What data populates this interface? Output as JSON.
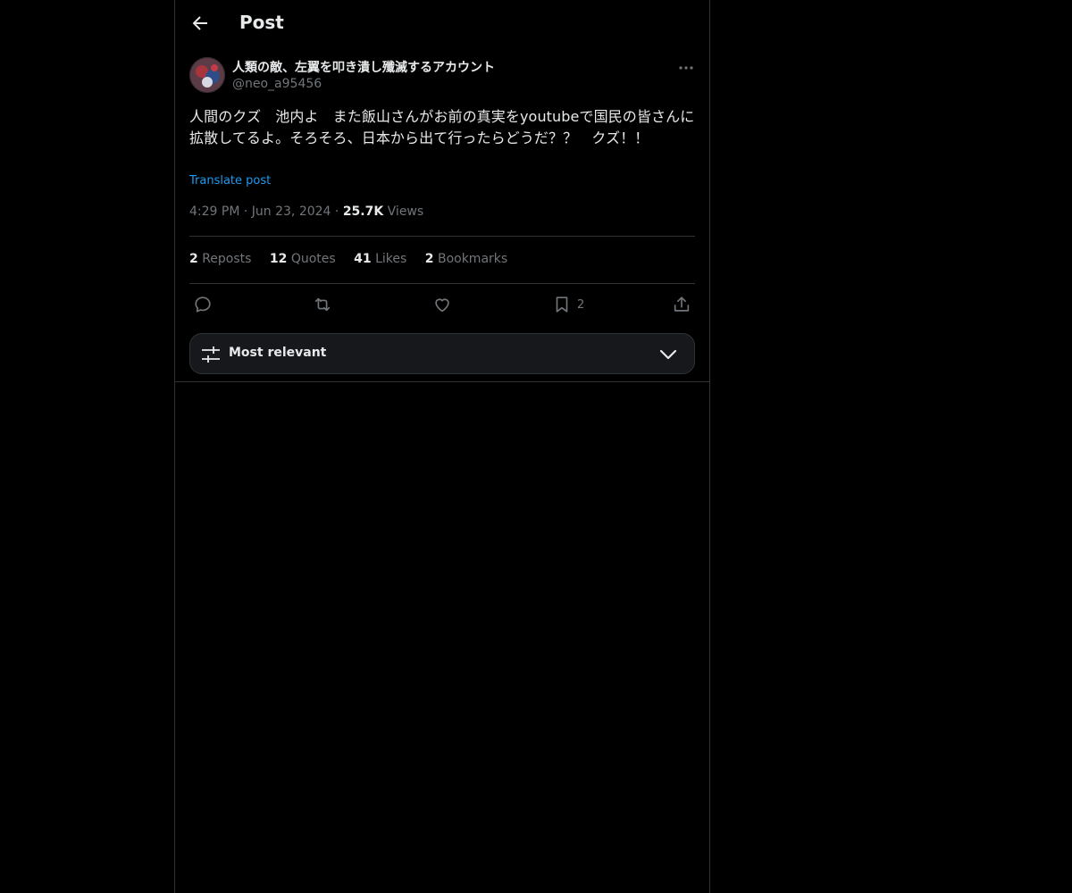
{
  "header": {
    "title": "Post",
    "back_icon": "arrow-left-icon"
  },
  "author": {
    "display_name": "人類の敵、左翼を叩き潰し殲滅するアカウント",
    "handle": "@neo_a95456"
  },
  "post": {
    "text": "人間のクズ　池内よ　また飯山さんがお前の真実をyoutubeで国民の皆さんに拡散してるよ。そろそろ、日本から出て行ったらどうだ？？　クズ！！",
    "translate_label": "Translate post",
    "time": "4:29 PM",
    "date": "Jun 23, 2024",
    "views_count": "25.7K",
    "views_label": "Views"
  },
  "stats": {
    "reposts_count": "2",
    "reposts_label": "Reposts",
    "quotes_count": "12",
    "quotes_label": "Quotes",
    "likes_count": "41",
    "likes_label": "Likes",
    "bookmarks_count": "2",
    "bookmarks_label": "Bookmarks"
  },
  "actions": {
    "bookmark_count": "2"
  },
  "sort": {
    "label": "Most relevant"
  },
  "colors": {
    "background": "#000000",
    "text": "#e7e9ea",
    "muted": "#71767b",
    "link": "#1d9bf0",
    "border": "#2f3336"
  }
}
